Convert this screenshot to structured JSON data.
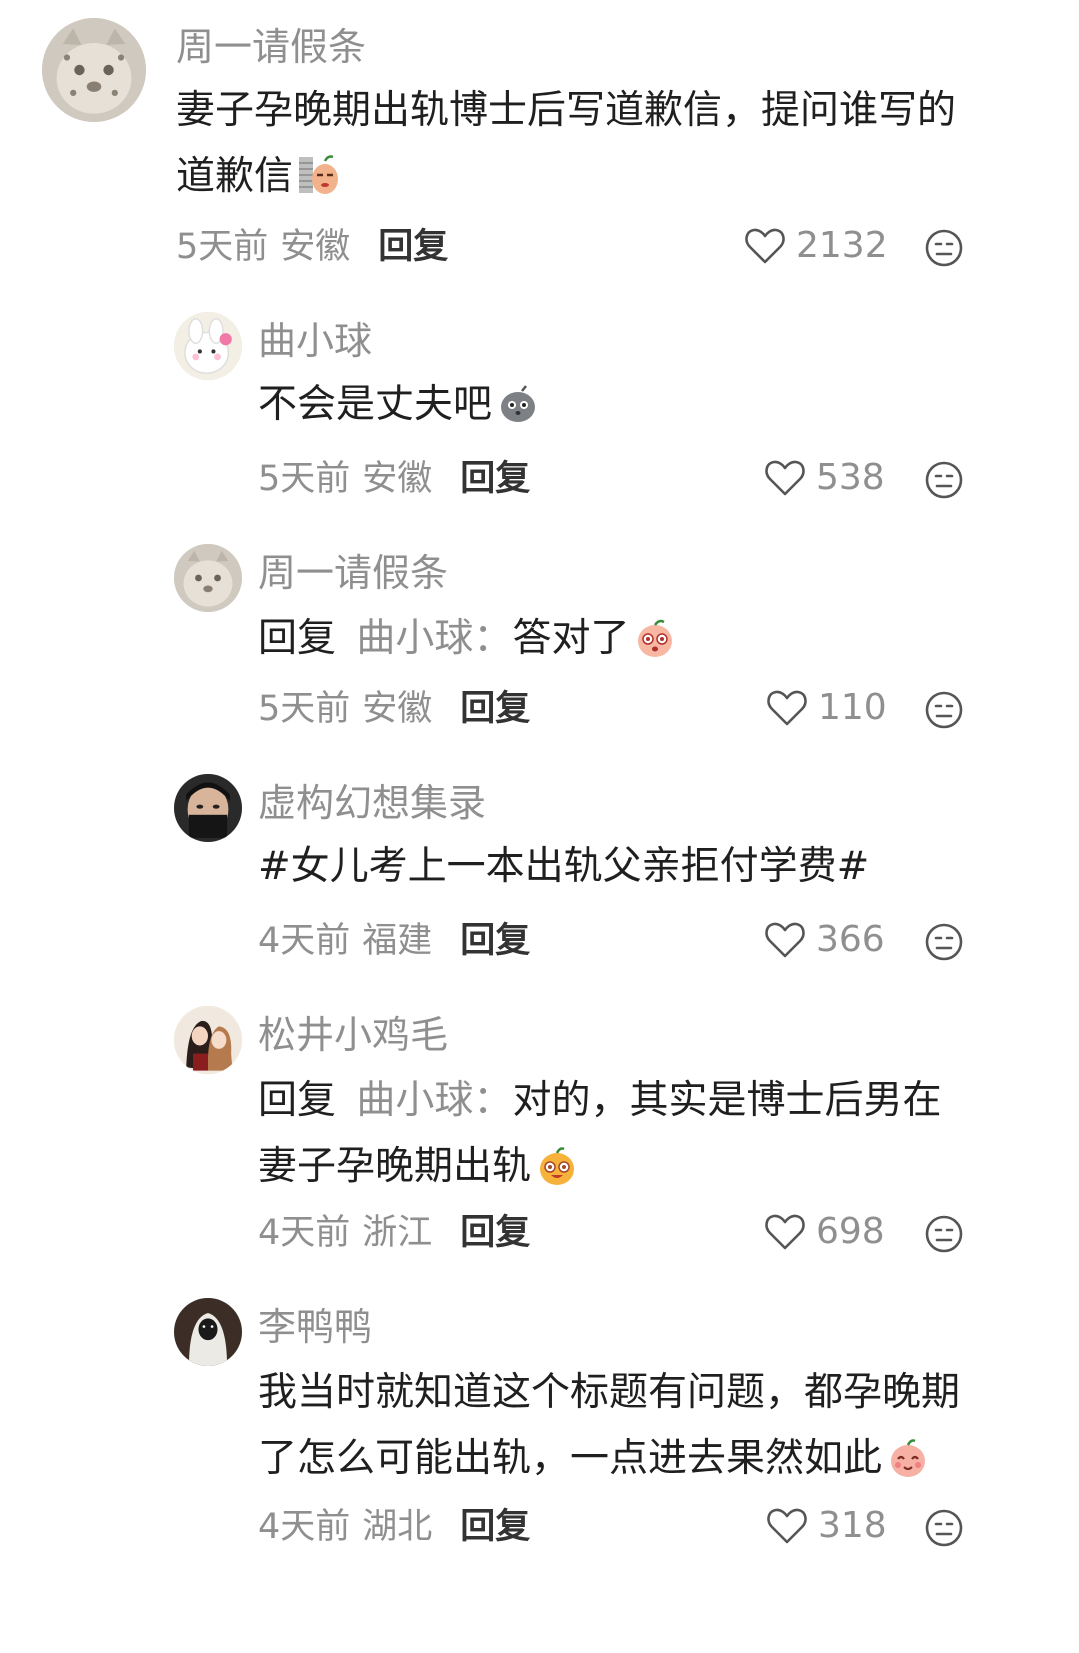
{
  "comments": [
    {
      "username": "周一请假条",
      "text": "妻子孕晚期出轨博士后写道歉信，提问谁写的道歉信",
      "emoji": "wall-peek-emoji",
      "time": "5天前",
      "location": "安徽",
      "reply_label": "回复",
      "likes": "2132",
      "avatar": "snow-leopard-avatar"
    },
    {
      "username": "曲小球",
      "text": "不会是丈夫吧",
      "emoji": "gray-blob-emoji",
      "time": "5天前",
      "location": "安徽",
      "reply_label": "回复",
      "likes": "538",
      "avatar": "white-bunny-avatar"
    },
    {
      "username": "周一请假条",
      "reply_prefix": "回复",
      "reply_target": "曲小球：",
      "text": "答对了",
      "emoji": "peach-surprised-emoji",
      "time": "5天前",
      "location": "安徽",
      "reply_label": "回复",
      "likes": "110",
      "avatar": "snow-leopard-avatar"
    },
    {
      "username": "虚构幻想集录",
      "text": "#女儿考上一本出轨父亲拒付学费#",
      "time": "4天前",
      "location": "福建",
      "reply_label": "回复",
      "likes": "366",
      "avatar": "masked-face-avatar"
    },
    {
      "username": "松井小鸡毛",
      "reply_prefix": "回复",
      "reply_target": "曲小球：",
      "text": "对的，其实是博士后男在妻子孕晚期出轨",
      "emoji": "orange-blob-emoji",
      "time": "4天前",
      "location": "浙江",
      "reply_label": "回复",
      "likes": "698",
      "avatar": "anime-couple-avatar"
    },
    {
      "username": "李鸭鸭",
      "text": "我当时就知道这个标题有问题，都孕晚期了怎么可能出轨，一点进去果然如此",
      "emoji": "peach-smile-emoji",
      "time": "4天前",
      "location": "湖北",
      "reply_label": "回复",
      "likes": "318",
      "avatar": "hooded-figure-avatar"
    }
  ]
}
